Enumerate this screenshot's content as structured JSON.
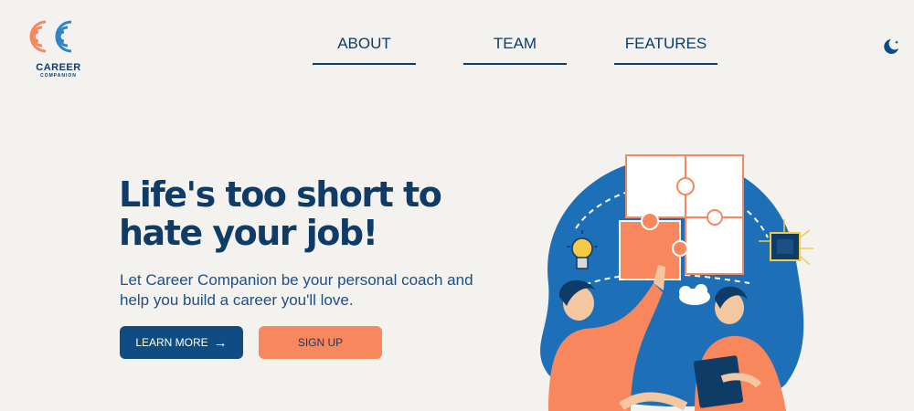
{
  "brand": {
    "name": "CAREER",
    "sub": "COMPANION",
    "logo_icon": "cc-maze-logo-icon"
  },
  "nav": {
    "items": [
      {
        "label": "ABOUT"
      },
      {
        "label": "TEAM"
      },
      {
        "label": "FEATURES"
      }
    ]
  },
  "theme_toggle": {
    "icon": "moon-icon"
  },
  "hero": {
    "headline": "Life's too short to hate your job!",
    "subtext": "Let Career Companion be your personal coach and help you build a career you'll love.",
    "learn_more_label": "LEARN MORE",
    "signup_label": "SIGN UP"
  },
  "colors": {
    "navy": "#0f3b67",
    "blue": "#0f4c81",
    "orange": "#f9875d",
    "background": "#f4f2ef"
  }
}
